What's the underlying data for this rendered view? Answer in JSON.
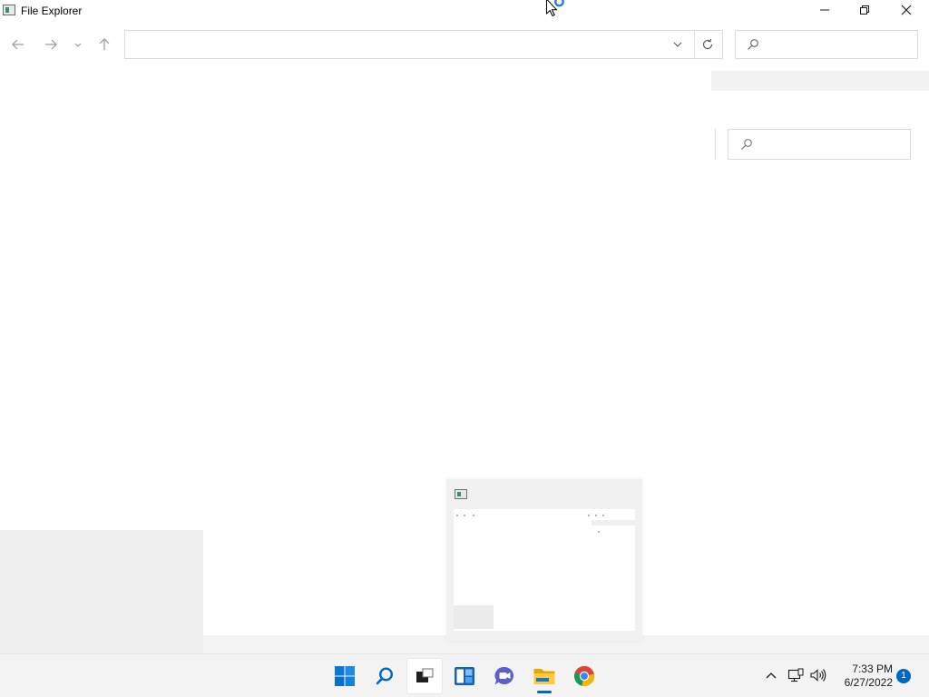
{
  "window": {
    "title": "File Explorer",
    "icon": "file-explorer-app-icon"
  },
  "window_controls": {
    "minimize_icon": "minimize-icon",
    "maximize_icon": "restore-icon",
    "close_icon": "close-icon"
  },
  "navigation": {
    "back_icon": "arrow-left-icon",
    "forward_icon": "arrow-right-icon",
    "recent_icon": "chevron-down-icon",
    "up_icon": "arrow-up-icon"
  },
  "address_bar": {
    "value": "",
    "dropdown_icon": "chevron-down-icon",
    "refresh_icon": "refresh-icon"
  },
  "search": {
    "value": "",
    "icon": "search-icon"
  },
  "taskbar": {
    "apps": [
      {
        "name": "Start",
        "icon": "windows-start-icon",
        "active": false
      },
      {
        "name": "Search",
        "icon": "search-icon",
        "active": false
      },
      {
        "name": "Task View",
        "icon": "task-view-icon",
        "active": true
      },
      {
        "name": "Widgets",
        "icon": "widgets-icon",
        "active": false
      },
      {
        "name": "Chat",
        "icon": "teams-chat-icon",
        "active": false
      },
      {
        "name": "File Explorer",
        "icon": "folder-icon",
        "active": false,
        "running": true
      },
      {
        "name": "Google Chrome",
        "icon": "chrome-icon",
        "active": false
      }
    ],
    "tray": {
      "overflow_icon": "chevron-up-icon",
      "network_icon": "network-icon",
      "volume_icon": "volume-icon"
    },
    "clock": {
      "time": "7:33 PM",
      "date": "6/27/2022"
    },
    "notification_count": "1"
  },
  "colors": {
    "accent": "#0067c0",
    "taskbar_bg": "#f3f3f3"
  }
}
